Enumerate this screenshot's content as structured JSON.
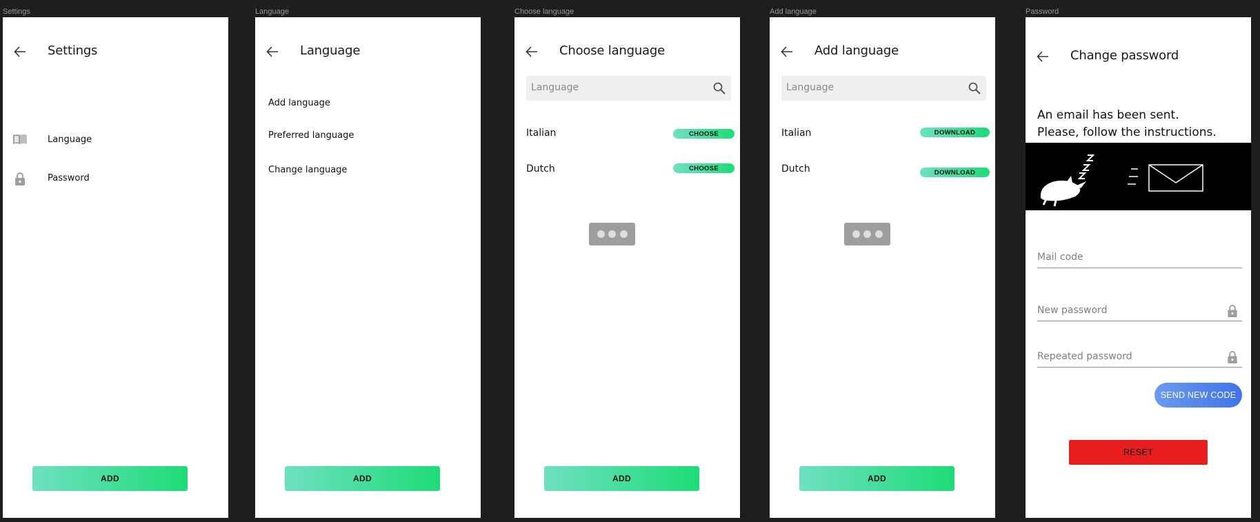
{
  "screens": {
    "settings": {
      "frame_label": "Settings",
      "title": "Settings",
      "items": [
        {
          "label": "Language",
          "icon": "book-icon"
        },
        {
          "label": "Password",
          "icon": "lock-icon"
        }
      ],
      "add_label": "ADD"
    },
    "language": {
      "frame_label": "Language",
      "title": "Language",
      "items": [
        "Add language",
        "Preferred language",
        "Change language"
      ],
      "add_label": "ADD"
    },
    "choose_language": {
      "frame_label": "Choose language",
      "title": "Choose language",
      "search_placeholder": "Language",
      "languages": [
        {
          "name": "Italian",
          "action": "CHOOSE"
        },
        {
          "name": "Dutch",
          "action": "CHOOSE"
        }
      ],
      "add_label": "ADD"
    },
    "add_language": {
      "frame_label": "Add language",
      "title": "Add language",
      "search_placeholder": "Language",
      "languages": [
        {
          "name": "Italian",
          "action": "DOWNLOAD"
        },
        {
          "name": "Dutch",
          "action": "DOWNLOAD"
        }
      ],
      "add_label": "ADD"
    },
    "password": {
      "frame_label": "Password",
      "title": "Change password",
      "message_line1": "An email has been sent.",
      "message_line2": "Please, follow the instructions.",
      "fields": [
        {
          "placeholder": "Mail code",
          "icon": ""
        },
        {
          "placeholder": "New password",
          "icon": "lock-icon"
        },
        {
          "placeholder": "Repeated password",
          "icon": "lock-icon"
        }
      ],
      "send_code_label": "SEND NEW CODE",
      "reset_label": "RESET"
    }
  },
  "colors": {
    "background": "#1e1e1e",
    "green_start": "#6fe0c2",
    "green_end": "#1ddc76",
    "blue_button": "#4f86ec",
    "reset_red": "#e81d1d"
  }
}
